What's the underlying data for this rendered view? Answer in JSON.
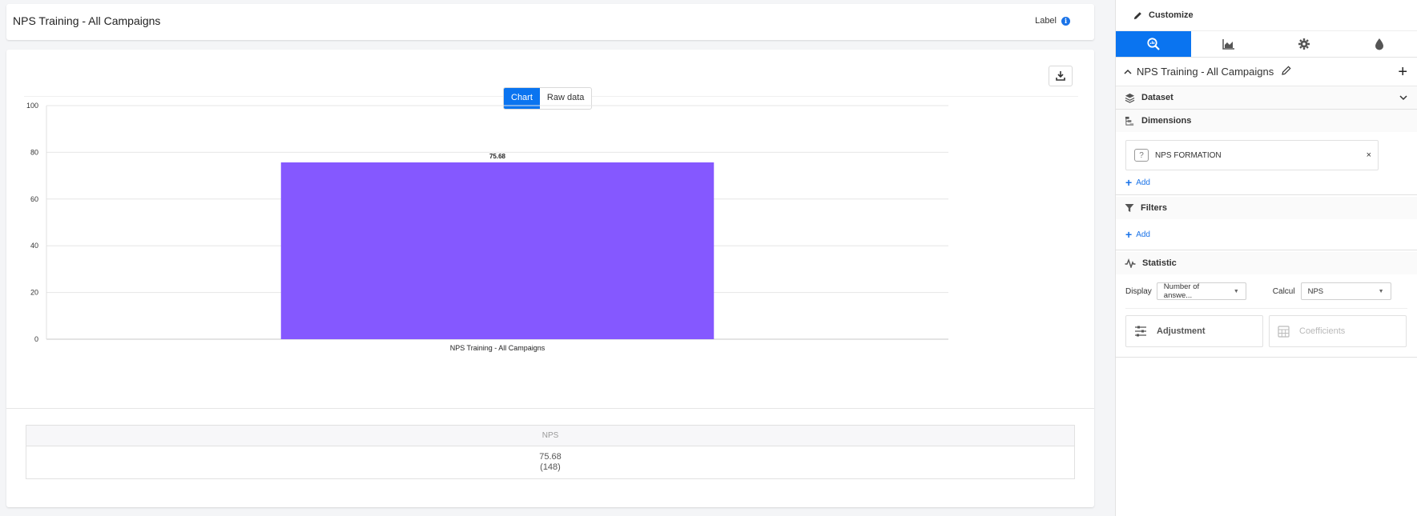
{
  "header": {
    "title": "NPS Training - All Campaigns",
    "label_text": "Label",
    "info_icon": "i"
  },
  "chart_card": {
    "toggle": {
      "chart_label": "Chart",
      "raw_label": "Raw data"
    },
    "table": {
      "header": "NPS",
      "value": "75.68",
      "count": "(148)"
    }
  },
  "chart_data": {
    "type": "bar",
    "categories": [
      "NPS Training - All Campaigns"
    ],
    "values": [
      75.68
    ],
    "data_labels": [
      "75.68"
    ],
    "ylim": [
      0,
      100
    ],
    "yticks": [
      "0",
      "20",
      "40",
      "60",
      "80",
      "100"
    ],
    "grid": true,
    "color": "#8558ff"
  },
  "panel": {
    "customize_label": "Customize",
    "analysis_name": "NPS Training - All Campaigns",
    "dataset_label": "Dataset",
    "dimensions_label": "Dimensions",
    "dimension_item": "NPS FORMATION",
    "dimension_icon": "?",
    "remove_symbol": "×",
    "add_label": "Add",
    "filters_label": "Filters",
    "statistic_label": "Statistic",
    "display_label": "Display",
    "display_value": "Number of answe...",
    "calcul_label": "Calcul",
    "calcul_value": "NPS",
    "adjustment_label": "Adjustment",
    "coefficients_label": "Coefficients",
    "plus_symbol": "+"
  },
  "colors": {
    "accent": "#0a74f0",
    "bar": "#8558ff"
  }
}
